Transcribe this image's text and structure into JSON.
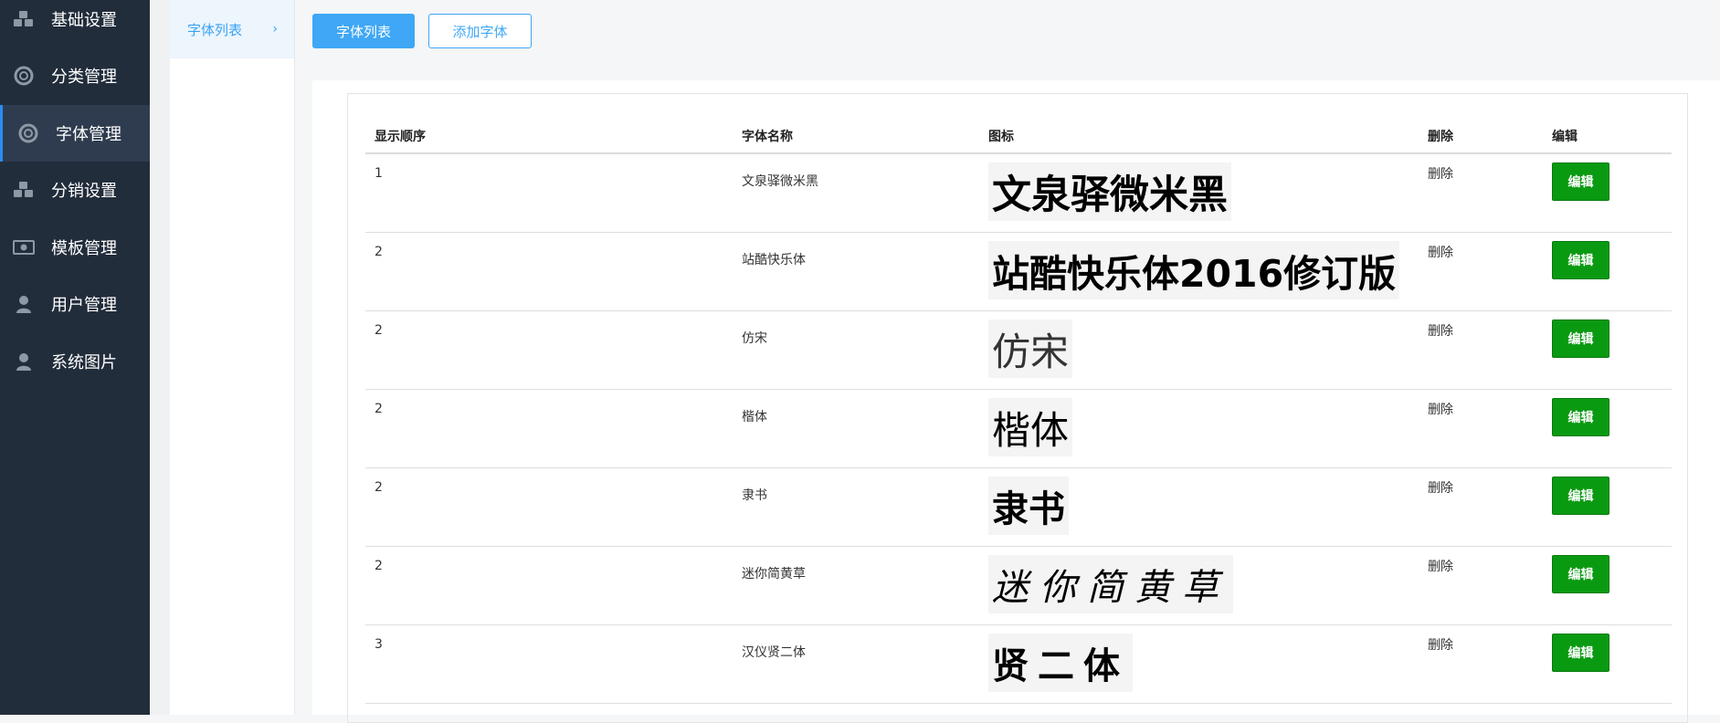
{
  "sidebar": {
    "items": [
      {
        "label": "基础设置",
        "icon": "cubes-icon"
      },
      {
        "label": "分类管理",
        "icon": "lifebuoy-icon"
      },
      {
        "label": "字体管理",
        "icon": "lifebuoy-icon",
        "active": true
      },
      {
        "label": "分销设置",
        "icon": "cubes-icon"
      },
      {
        "label": "模板管理",
        "icon": "money-icon"
      },
      {
        "label": "用户管理",
        "icon": "user-icon"
      },
      {
        "label": "系统图片",
        "icon": "user-icon"
      }
    ]
  },
  "subnav": {
    "item_label": "字体列表",
    "chevron": "›"
  },
  "tabs": {
    "primary_label": "字体列表",
    "secondary_label": "添加字体"
  },
  "table": {
    "headers": {
      "order": "显示顺序",
      "name": "字体名称",
      "icon": "图标",
      "delete": "删除",
      "edit": "编辑"
    },
    "rows": [
      {
        "order": "1",
        "name": "文泉驿微米黑",
        "preview": "文泉驿微米黑",
        "delete": "删除",
        "edit": "编辑"
      },
      {
        "order": "2",
        "name": "站酷快乐体",
        "preview": "站酷快乐体2016修订版",
        "delete": "删除",
        "edit": "编辑"
      },
      {
        "order": "2",
        "name": "仿宋",
        "preview": "仿宋",
        "delete": "删除",
        "edit": "编辑"
      },
      {
        "order": "2",
        "name": "楷体",
        "preview": "楷体",
        "delete": "删除",
        "edit": "编辑"
      },
      {
        "order": "2",
        "name": "隶书",
        "preview": "隶书",
        "delete": "删除",
        "edit": "编辑"
      },
      {
        "order": "2",
        "name": "迷你简黄草",
        "preview": "迷你简黄草",
        "delete": "删除",
        "edit": "编辑"
      },
      {
        "order": "3",
        "name": "汉仪贤二体",
        "preview": "贤二体",
        "delete": "删除",
        "edit": "编辑"
      }
    ]
  },
  "colors": {
    "sidebar_bg": "#222d3b",
    "accent_blue": "#3fa7f5",
    "edit_green": "#0a9a12"
  }
}
